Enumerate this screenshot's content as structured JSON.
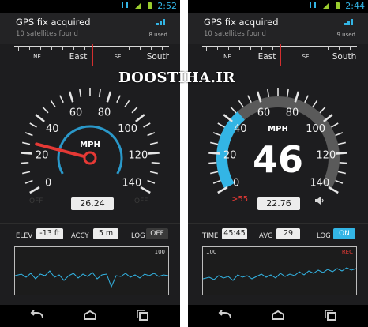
{
  "watermark": "DOOSTIHA.IR",
  "colors": {
    "accent": "#33b5e5",
    "needle": "#d32f2f",
    "background": "#1d1d1f"
  },
  "left": {
    "status_time": "2:52",
    "gps_title": "GPS fix acquired",
    "gps_subtitle": "10 satellites found",
    "sats_used": "8 used",
    "compass": [
      "NE",
      "East",
      "SE",
      "South"
    ],
    "gauge": {
      "unit": "MPH",
      "ticks": [
        "0",
        "20",
        "40",
        "60",
        "80",
        "100",
        "120",
        "140"
      ],
      "speed_mph": 26
    },
    "off_left": "OFF",
    "readout": "26.24",
    "off_right": "OFF",
    "controls": {
      "elev_label": "ELEV",
      "elev_value": "-13 ft",
      "accy_label": "ACCY",
      "accy_value": "5 m",
      "log_label": "LOG",
      "log_state": "OFF"
    },
    "graph_max": "100"
  },
  "right": {
    "status_time": "2:44",
    "gps_title": "GPS fix acquired",
    "gps_subtitle": "10 satellites found",
    "sats_used": "9 used",
    "compass": [
      "NE",
      "East",
      "SE",
      "South"
    ],
    "gauge": {
      "unit": "MPH",
      "ticks": [
        "0",
        "20",
        "40",
        "60",
        "80",
        "100",
        "120",
        "140"
      ],
      "speed": "46",
      "speed_mph": 46
    },
    "speed_limit": ">55",
    "readout": "22.76",
    "controls": {
      "time_label": "TIME",
      "time_value": "45:45",
      "avg_label": "AVG",
      "avg_value": "29",
      "log_label": "LOG",
      "log_state": "ON"
    },
    "graph_max": "100",
    "graph_rec": "REC"
  }
}
